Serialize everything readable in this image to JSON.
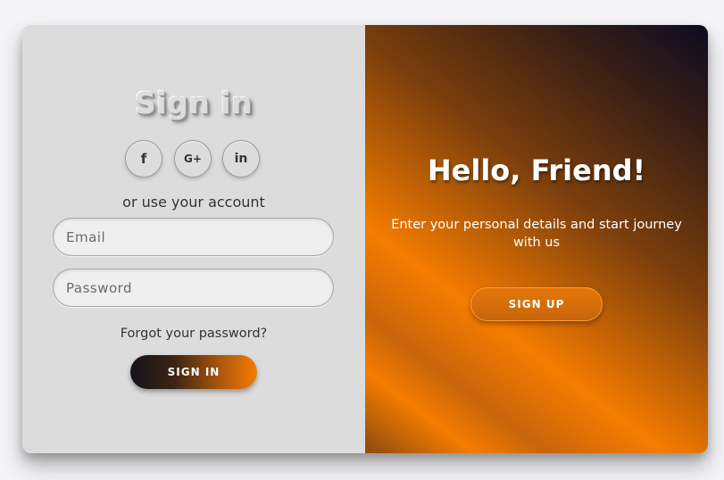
{
  "sign_in_panel": {
    "title": "Sign in",
    "social_buttons": [
      {
        "label": "f",
        "icon": "facebook-icon"
      },
      {
        "label": "G+",
        "icon": "google-plus-icon"
      },
      {
        "label": "in",
        "icon": "linkedin-icon"
      }
    ],
    "subtitle": "or use your account",
    "email_placeholder": "Email",
    "password_placeholder": "Password",
    "forgot_label": "Forgot your password?",
    "signin_label": "SIGN IN"
  },
  "overlay_panel": {
    "title": "Hello, Friend!",
    "description": "Enter your personal details and start journey with us",
    "signup_label": "SIGN UP"
  },
  "colors": {
    "accent": "#f57c00",
    "dark": "#0c0b22",
    "panel_background": "#dcdcdc"
  }
}
